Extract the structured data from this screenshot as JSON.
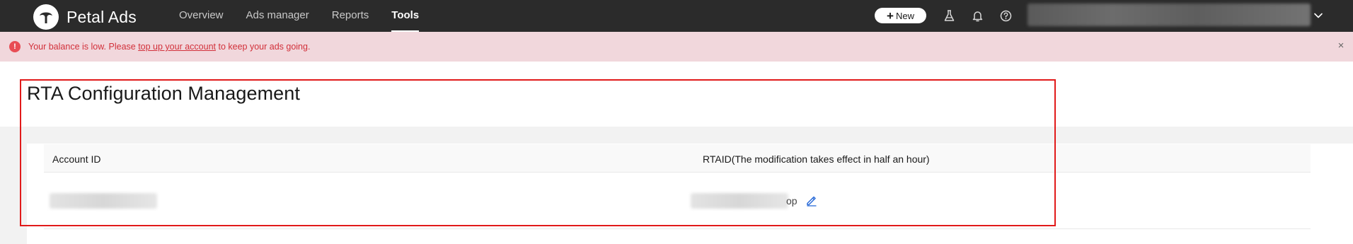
{
  "brand": {
    "name": "Petal Ads"
  },
  "nav": {
    "items": [
      {
        "label": "Overview",
        "active": false
      },
      {
        "label": "Ads manager",
        "active": false
      },
      {
        "label": "Reports",
        "active": false
      },
      {
        "label": "Tools",
        "active": true
      }
    ]
  },
  "toolbar": {
    "new_label": "New",
    "icons": [
      "flask-icon",
      "bell-icon",
      "help-icon"
    ]
  },
  "alert": {
    "text_before": "Your balance is low. Please ",
    "link_text": "top up your account",
    "text_after": " to keep your ads going.",
    "close_symbol": "×"
  },
  "page": {
    "title": "RTA Configuration Management"
  },
  "table": {
    "columns": [
      "Account ID",
      "RTAID(The modification takes effect in half an hour)"
    ],
    "rows": [
      {
        "rtaid_visible_suffix": "op"
      }
    ]
  },
  "colors": {
    "topbar": "#2b2b2b",
    "alert_bg": "#f1d7dc",
    "alert_text": "#d2303a",
    "edit_icon": "#2a6bd8",
    "highlight": "#e11a1a"
  }
}
